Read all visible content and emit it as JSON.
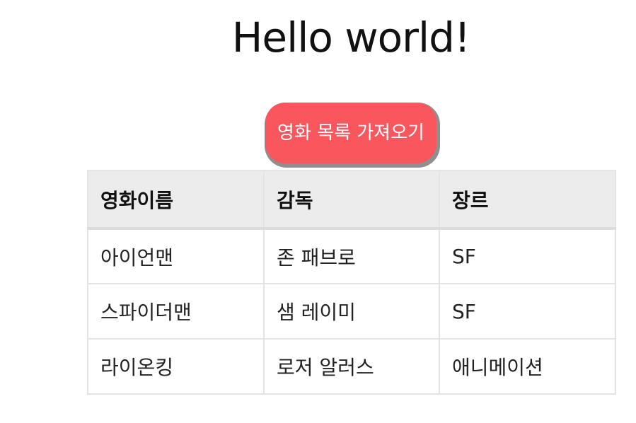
{
  "page": {
    "title": "Hello world!"
  },
  "button": {
    "label": "영화 목록 가져오기",
    "color": "#f9575d"
  },
  "table": {
    "headers": [
      "영화이름",
      "감독",
      "장르"
    ],
    "rows": [
      [
        "아이언맨",
        "존 패브로",
        "SF"
      ],
      [
        "스파이더맨",
        "샘 레이미",
        "SF"
      ],
      [
        "라이온킹",
        "로저 알러스",
        "애니메이션"
      ]
    ]
  }
}
